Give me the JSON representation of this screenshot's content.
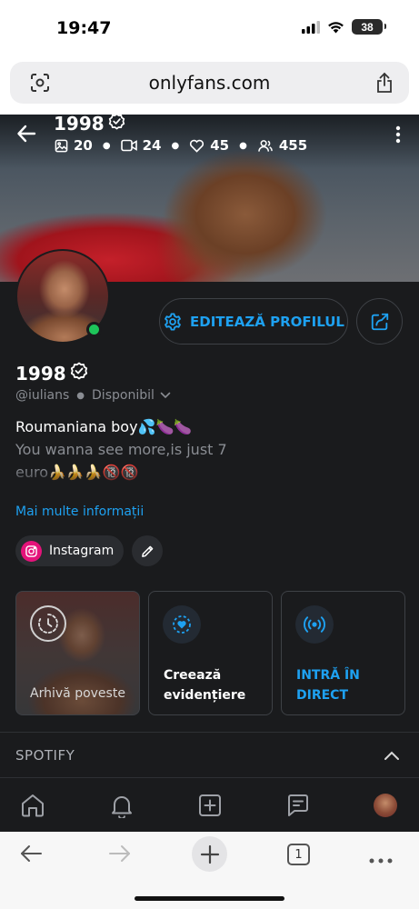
{
  "status_bar": {
    "time": "19:47",
    "battery": "38"
  },
  "browser": {
    "url": "onlyfans.com",
    "tab_count": "1"
  },
  "cover": {
    "name": "1998",
    "stats": {
      "photos": "20",
      "videos": "24",
      "likes": "45",
      "fans": "455"
    }
  },
  "profile": {
    "edit_label": "EDITEAZĂ PROFILUL",
    "name": "1998",
    "handle": "@iulians",
    "availability": "Disponibil",
    "bio": {
      "line1": "Roumaniana boy💦🍆🍆",
      "line2": "You wanna see more,is just 7",
      "line3": "euro🍌🍌🍌🔞🔞"
    },
    "more_info": "Mai multe informații",
    "social": {
      "instagram_label": "Instagram"
    }
  },
  "highlights": {
    "archive_label": "Arhivă poveste",
    "create_label_1": "Creează",
    "create_label_2": "evidențiere",
    "live_label_1": "INTRĂ ÎN",
    "live_label_2": "DIRECT"
  },
  "spotify": {
    "title": "SPOTIFY"
  },
  "colors": {
    "accent": "#1ea1f1",
    "background": "#1a1b1d",
    "online": "#1ec55a",
    "instagram": "#e4137a"
  },
  "icons": {
    "cover": [
      "back-arrow-icon",
      "image-icon",
      "video-icon",
      "heart-icon",
      "users-icon",
      "more-vertical-icon",
      "verified-icon"
    ],
    "nav": [
      "home-icon",
      "bell-icon",
      "plus-square-icon",
      "chat-icon",
      "avatar"
    ],
    "safari": [
      "back-icon",
      "forward-icon",
      "plus-icon",
      "tabs-icon",
      "more-icon"
    ]
  }
}
